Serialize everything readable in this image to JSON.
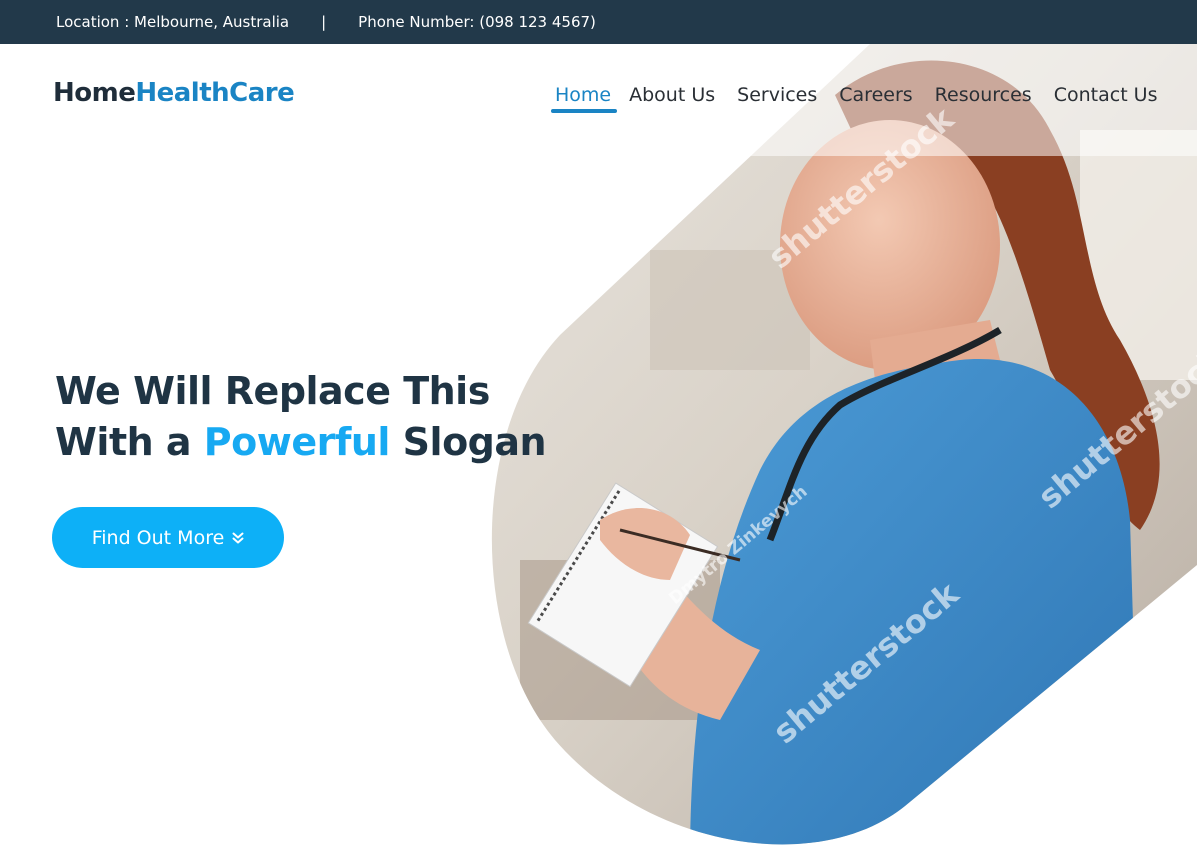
{
  "topbar": {
    "location": "Location : Melbourne, Australia",
    "separator": "|",
    "phone": "Phone Number: (098 123 4567)"
  },
  "logo": {
    "part1": "Home",
    "part2": "HealthCare"
  },
  "nav": {
    "items": [
      {
        "label": "Home",
        "active": true
      },
      {
        "label": "About Us"
      },
      {
        "label": "Services"
      },
      {
        "label": "Careers"
      },
      {
        "label": "Resources"
      },
      {
        "label": "Contact Us"
      }
    ]
  },
  "hero": {
    "line1": "We Will Replace This",
    "line2_prefix": "With a ",
    "line2_accent": "Powerful",
    "line2_suffix": " Slogan",
    "cta_label": "Find Out More",
    "cta_icon": "double-chevron-down-icon"
  },
  "watermark": {
    "brand": "shutterstock",
    "author": "Dmytro Zinkevych"
  },
  "colors": {
    "topbar_bg": "#22394a",
    "brand_blue": "#1a84c4",
    "accent": "#17a9f2",
    "cta_bg": "#0db0f7",
    "heading": "#1f3444"
  }
}
